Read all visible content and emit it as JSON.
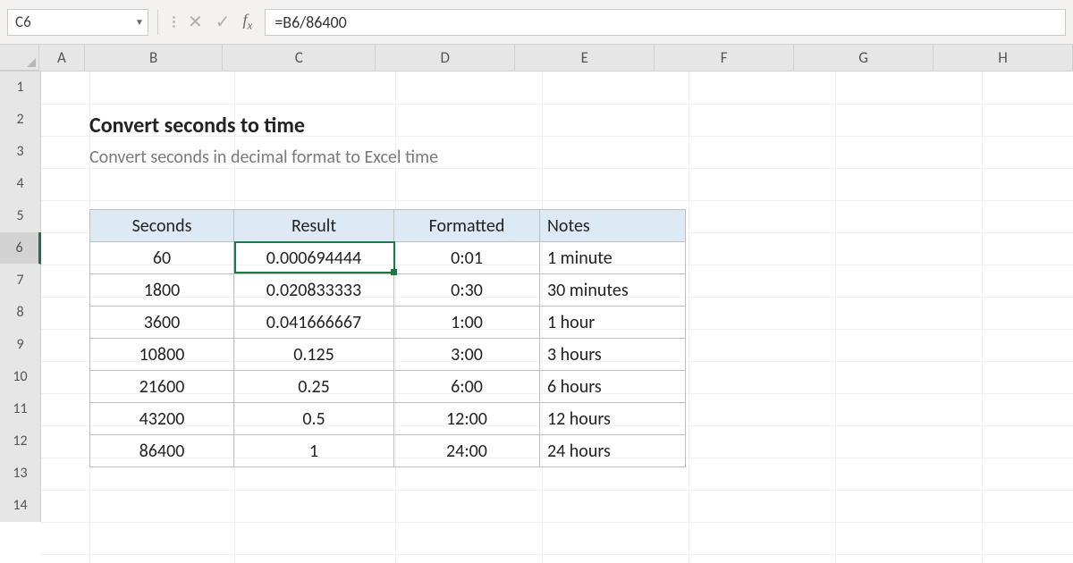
{
  "name_box": "C6",
  "formula": "=B6/86400",
  "columns": [
    "A",
    "B",
    "C",
    "D",
    "E",
    "F",
    "G",
    "H"
  ],
  "rows": [
    "1",
    "2",
    "3",
    "4",
    "5",
    "6",
    "7",
    "8",
    "9",
    "10",
    "11",
    "12",
    "13",
    "14"
  ],
  "active_row": "6",
  "title": "Convert seconds to time",
  "subtitle": "Convert seconds in decimal format to Excel time",
  "headers": {
    "seconds": "Seconds",
    "result": "Result",
    "formatted": "Formatted",
    "notes": "Notes"
  },
  "data": [
    {
      "seconds": "60",
      "result": "0.000694444",
      "formatted": "0:01",
      "notes": "1 minute"
    },
    {
      "seconds": "1800",
      "result": "0.020833333",
      "formatted": "0:30",
      "notes": "30 minutes"
    },
    {
      "seconds": "3600",
      "result": "0.041666667",
      "formatted": "1:00",
      "notes": "1 hour"
    },
    {
      "seconds": "10800",
      "result": "0.125",
      "formatted": "3:00",
      "notes": "3 hours"
    },
    {
      "seconds": "21600",
      "result": "0.25",
      "formatted": "6:00",
      "notes": "6 hours"
    },
    {
      "seconds": "43200",
      "result": "0.5",
      "formatted": "12:00",
      "notes": "12 hours"
    },
    {
      "seconds": "86400",
      "result": "1",
      "formatted": "24:00",
      "notes": "24 hours"
    }
  ]
}
